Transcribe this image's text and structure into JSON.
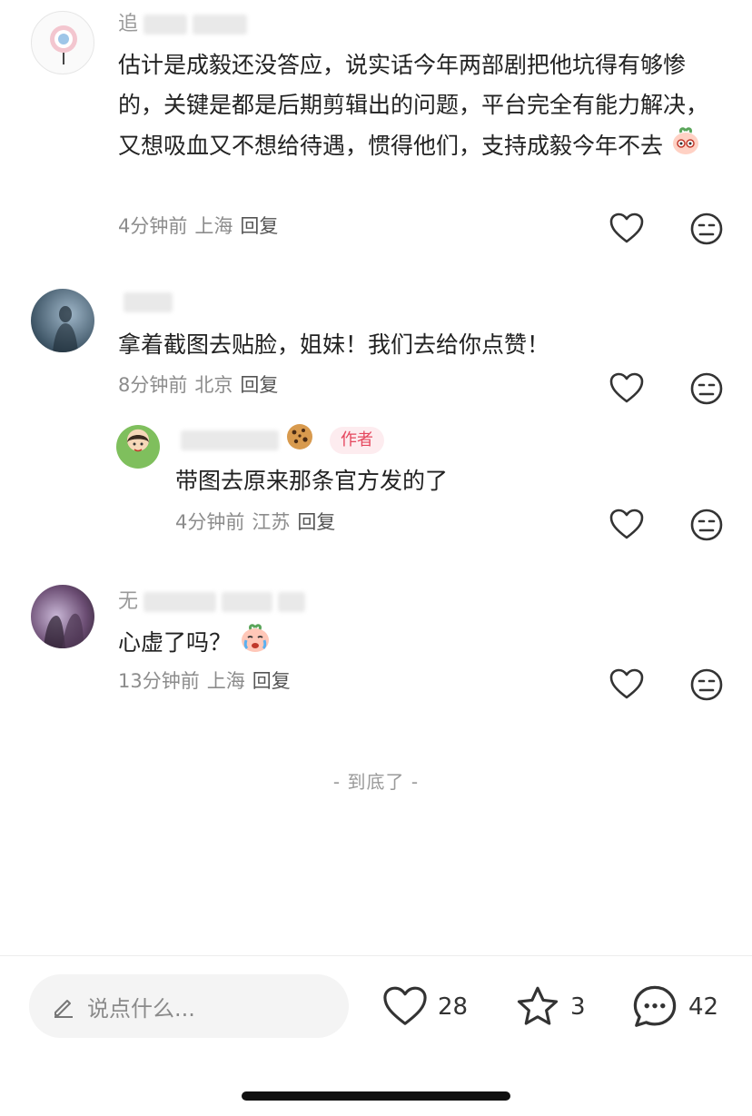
{
  "comments": [
    {
      "name_visible": "追",
      "text": "估计是成毅还没答应，说实话今年两部剧把他坑得有够惨的，关键是都是后期剪辑出的问题，平台完全有能力解决，又想吸血又不想给待遇，惯得他们，支持成毅今年不去",
      "emoji": "peach-emoji",
      "time": "4分钟前",
      "location": "上海",
      "reply_label": "回复"
    },
    {
      "name_visible": "",
      "text": "拿着截图去贴脸，姐妹！我们去给你点赞！",
      "time": "8分钟前",
      "location": "北京",
      "reply_label": "回复",
      "sub_reply": {
        "name_visible": "",
        "name_emoji": "cookie-emoji",
        "author_tag": "作者",
        "text": "带图去原来那条官方发的了",
        "time": "4分钟前",
        "location": "江苏",
        "reply_label": "回复"
      }
    },
    {
      "name_visible": "无",
      "text": "心虚了吗？",
      "emoji": "crying-peach-emoji",
      "time": "13分钟前",
      "location": "上海",
      "reply_label": "回复"
    }
  ],
  "end_text": "- 到底了 -",
  "bottom_bar": {
    "input_placeholder": "说点什么...",
    "like_count": "28",
    "star_count": "3",
    "comment_count": "42"
  },
  "colors": {
    "author_tag_text": "#e5475e",
    "author_tag_bg": "#fdecef",
    "meta_text": "#8c8c8c"
  }
}
